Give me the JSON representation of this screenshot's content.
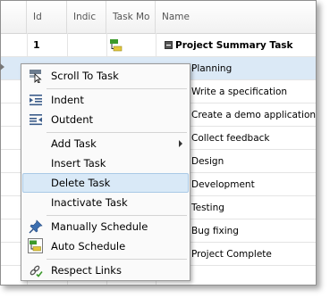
{
  "columns": {
    "id": "Id",
    "indicators": "Indic",
    "task_mode": "Task Mo",
    "name": "Name"
  },
  "rows": [
    {
      "id": "1",
      "name": "Project Summary Task",
      "summary": true
    },
    {
      "id": "",
      "name": "Planning"
    },
    {
      "id": "",
      "name": "Write a specification"
    },
    {
      "id": "",
      "name": "Create a demo application"
    },
    {
      "id": "",
      "name": "Collect feedback"
    },
    {
      "id": "",
      "name": "Design"
    },
    {
      "id": "",
      "name": "Development"
    },
    {
      "id": "",
      "name": "Testing"
    },
    {
      "id": "",
      "name": "Bug fixing"
    },
    {
      "id": "",
      "name": "Project Complete"
    }
  ],
  "menu": {
    "scroll_to_task": "Scroll To Task",
    "indent": "Indent",
    "outdent": "Outdent",
    "add_task": "Add Task",
    "insert_task": "Insert Task",
    "delete_task": "Delete Task",
    "inactivate_task": "Inactivate Task",
    "manually_schedule": "Manually Schedule",
    "auto_schedule": "Auto Schedule",
    "respect_links": "Respect Links"
  },
  "colors": {
    "selection": "#dbe9f6",
    "highlight": "#d9e9f7",
    "auto_icon_green": "#3c9a2b",
    "auto_icon_yellow": "#e3c63a"
  }
}
